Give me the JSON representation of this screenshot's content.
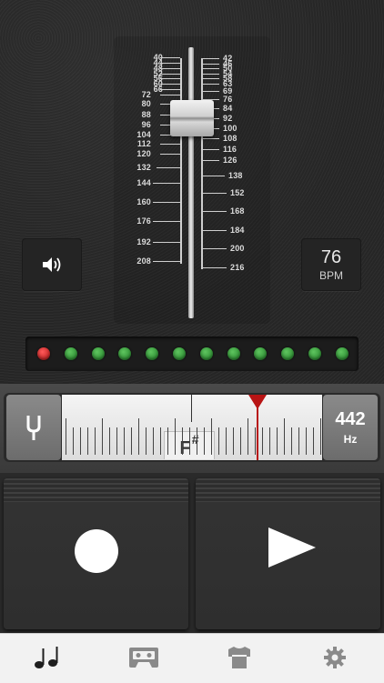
{
  "metronome": {
    "left_scale": [
      "40",
      "44",
      "48",
      "52",
      "56",
      "60",
      "66",
      "72",
      "80",
      "88",
      "96",
      "104",
      "112",
      "120",
      "132",
      "144",
      "160",
      "176",
      "192",
      "208"
    ],
    "right_scale": [
      "42",
      "46",
      "50",
      "54",
      "58",
      "63",
      "69",
      "76",
      "84",
      "92",
      "100",
      "108",
      "116",
      "126",
      "138",
      "152",
      "168",
      "184",
      "200",
      "216"
    ],
    "tempo_value": "76",
    "tempo_unit": "BPM",
    "beat_leds": [
      "red",
      "green",
      "green",
      "green",
      "green",
      "green",
      "green",
      "green",
      "green",
      "green",
      "green",
      "green"
    ]
  },
  "tuner": {
    "note": "F",
    "accidental": "#",
    "reference_value": "442",
    "reference_unit": "Hz"
  },
  "icons": {
    "speaker": "speaker-icon",
    "fork": "tuning-fork-icon",
    "record": "record-icon",
    "play": "play-icon"
  },
  "tabs": [
    "metronome-icon",
    "cassette-icon",
    "shirt-icon",
    "gear-icon"
  ]
}
